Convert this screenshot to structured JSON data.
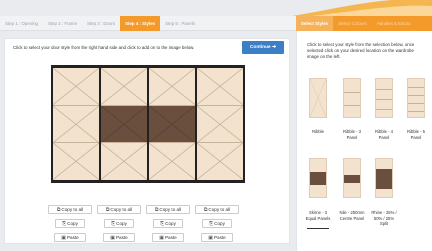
{
  "steps": [
    {
      "label": "Step 1 : Opening",
      "active": false
    },
    {
      "label": "Step 2 : Frame",
      "active": false
    },
    {
      "label": "Step 3 : Doors",
      "active": false
    },
    {
      "label": "Step 4 : Styles",
      "active": true
    },
    {
      "label": "Step 5 : Panels",
      "active": false
    }
  ],
  "tabs": [
    {
      "label": "Select Styles",
      "active": true
    },
    {
      "label": "Select Colours",
      "active": false
    },
    {
      "label": "Handles & Extras",
      "active": false
    }
  ],
  "left": {
    "instruction": "Click to select your door style from the right hand side and click to add on to the image below.",
    "continue_label": "Continue ➔"
  },
  "door_buttons": {
    "copy_to_all": "Copy to all",
    "copy": "Copy",
    "paste": "Paste"
  },
  "right": {
    "instruction": "Click to select your style from the selection below, once selected click on your desired location on the wardrobe image on the left.",
    "styles": [
      {
        "label": "Ribble"
      },
      {
        "label": "Ribble - 3 Panel"
      },
      {
        "label": "Ribble - 4 Panel"
      },
      {
        "label": "Ribble - 5 Panel"
      },
      {
        "label": "Skirne - 3 Equal Panels"
      },
      {
        "label": "Nile - 250mm Centre Panel"
      },
      {
        "label": "Rhine - 25% / 50% / 25% Split"
      }
    ]
  },
  "colors": {
    "accent": "#f39a2b",
    "button_blue": "#3d7fc6",
    "door_light": "#f2e2ce",
    "door_dark": "#6a4e3e",
    "frame": "#222222"
  }
}
